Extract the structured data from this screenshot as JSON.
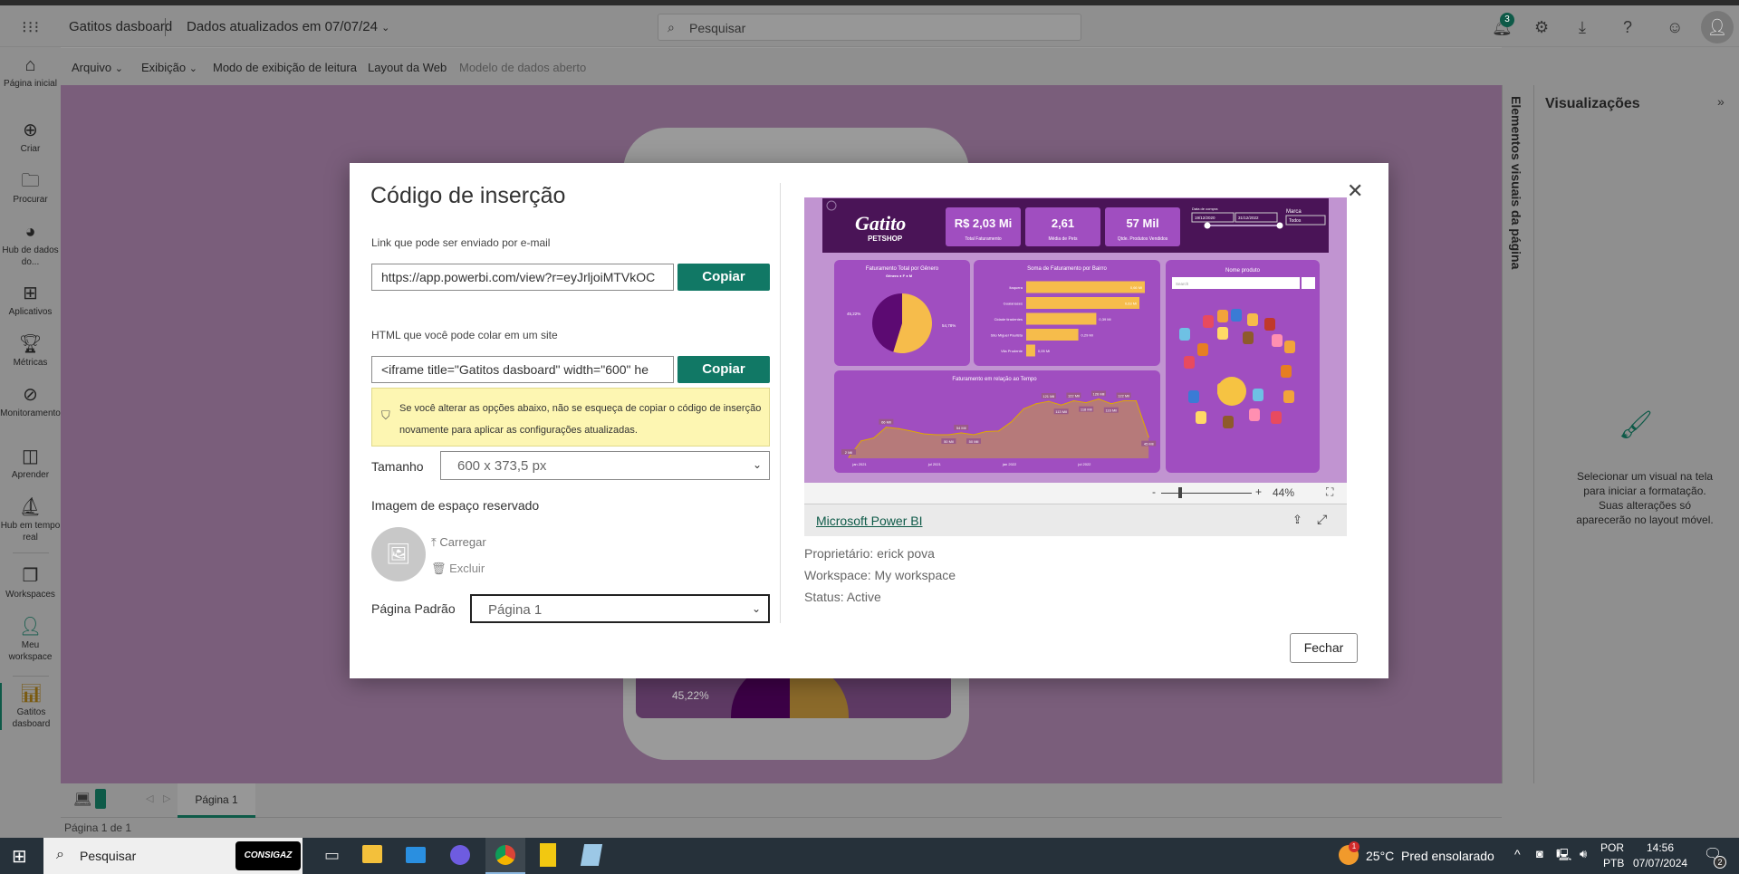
{
  "header": {
    "app_title": "Gatitos dasboard",
    "data_updated": "Dados atualizados em 07/07/24",
    "search_placeholder": "Pesquisar",
    "notification_count": "3"
  },
  "toolbar": {
    "items": [
      "Arquivo",
      "Exibição",
      "Modo de exibição de leitura",
      "Layout da Web",
      "Modelo de dados aberto"
    ]
  },
  "leftnav": [
    {
      "label": "Página inicial",
      "icon": "home-icon"
    },
    {
      "label": "Criar",
      "icon": "plus-circle-icon"
    },
    {
      "label": "Procurar",
      "icon": "folder-icon"
    },
    {
      "label": "Hub de dados do...",
      "icon": "data-hub-icon"
    },
    {
      "label": "Aplicativos",
      "icon": "apps-icon"
    },
    {
      "label": "Métricas",
      "icon": "trophy-icon"
    },
    {
      "label": "Monitoramento",
      "icon": "monitor-icon"
    },
    {
      "label": "Aprender",
      "icon": "book-icon"
    },
    {
      "label": "Hub em tempo real",
      "icon": "realtime-hub-icon"
    },
    {
      "label": "Workspaces",
      "icon": "workspaces-icon"
    },
    {
      "label": "Meu workspace",
      "icon": "person-icon"
    },
    {
      "label": "Gatitos dasboard",
      "icon": "report-icon"
    }
  ],
  "right_panel": {
    "vertical_label": "Elementos visuais da página",
    "title": "Visualizações",
    "help": "Selecionar um visual na tela para iniciar a formatação. Suas alterações só aparecerão no layout móvel."
  },
  "phone_preview": {
    "pie_label": "45,22%"
  },
  "pages": {
    "tab": "Página 1",
    "status": "Página 1 de 1"
  },
  "modal": {
    "title": "Código de inserção",
    "link_label": "Link que pode ser enviado por e-mail",
    "link_value": "https://app.powerbi.com/view?r=eyJrljoiMTVkOC",
    "copy_label": "Copiar",
    "html_label": "HTML que você pode colar em um site",
    "html_value": "<iframe title=\"Gatitos dasboard\" width=\"600\" he",
    "warning": "Se você alterar as opções abaixo, não se esqueça de copiar o código de inserção novamente para aplicar as configurações atualizadas.",
    "size_label": "Tamanho",
    "size_value": "600 x 373,5 px",
    "placeholder_label": "Imagem de espaço reservado",
    "upload_label": "Carregar",
    "delete_label": "Excluir",
    "default_page_label": "Página Padrão",
    "default_page_value": "Página 1",
    "zoom_value": "44%",
    "pbi_link": "Microsoft Power BI",
    "owner": "Proprietário: erick pova",
    "workspace": "Workspace: My workspace",
    "status": "Status: Active",
    "close_label": "Fechar"
  },
  "report": {
    "logo": "Gatito PETSHOP",
    "kpis": [
      {
        "value": "R$ 2,03 Mi",
        "label": "Total Faturamento"
      },
      {
        "value": "2,61",
        "label": "Média de Pets"
      },
      {
        "value": "57 Mil",
        "label": "Qtde. Produtos Vendidos"
      }
    ],
    "date_label": "Data de compra",
    "date_from": "19/12/2020",
    "date_to": "31/12/2022",
    "brand_label": "Marca",
    "brand_value": "Todos",
    "search_placeholder": "Search",
    "product_title": "Nome produto"
  },
  "chart_data": [
    {
      "type": "pie",
      "title": "Faturamento Total por Gênero",
      "legend_title": "Gênero",
      "categories": [
        "F",
        "M"
      ],
      "values": [
        54.78,
        45.22
      ],
      "labels": [
        "54,78%",
        "45,22%"
      ],
      "colors": [
        "#f6bc4b",
        "#5c0a72"
      ]
    },
    {
      "type": "bar",
      "title": "Soma de Faturamento por Bairro",
      "categories": [
        "Itaquera",
        "Guaianases",
        "Cidade tiradentes",
        "São Miguel Paulista",
        "Vila Prudente"
      ],
      "values": [
        0.66,
        0.63,
        0.39,
        0.29,
        0.05
      ],
      "labels": [
        "0,66 Mi",
        "0,63 Mi",
        "0,39 Mi",
        "0,29 Mi",
        "0,05 Mi"
      ],
      "color": "#f6bc4b"
    },
    {
      "type": "area",
      "title": "Faturamento em relação ao Tempo",
      "x_ticks": [
        "jan 2021",
        "jul 2021",
        "jan 2022",
        "jul 2022"
      ],
      "values": [
        2,
        37,
        43,
        66,
        63,
        58,
        52,
        50,
        50,
        54,
        50,
        57,
        58,
        77,
        105,
        116,
        121,
        113,
        122,
        118,
        126,
        116,
        122,
        122,
        45
      ],
      "point_labels": {
        "0": "2 Mil",
        "3": "66 Mil",
        "8": "50 Mil",
        "9": "54 Mil",
        "10": "50 Mil",
        "16": "121 Mil",
        "17": "113 Mil",
        "18": "122 Mil",
        "19": "118 Mil",
        "20": "126 Mil",
        "21": "116 Mil",
        "22": "122 Mil",
        "24": "45 Mil"
      },
      "color": "#e0a800"
    }
  ],
  "taskbar": {
    "search": "Pesquisar",
    "pinned": "CONSIGAZ",
    "weather": "25°C  Pred ensolarado",
    "weather_badge": "1",
    "lang1": "POR",
    "lang2": "PTB",
    "time": "14:56",
    "date": "07/07/2024",
    "notif_count": "2"
  }
}
